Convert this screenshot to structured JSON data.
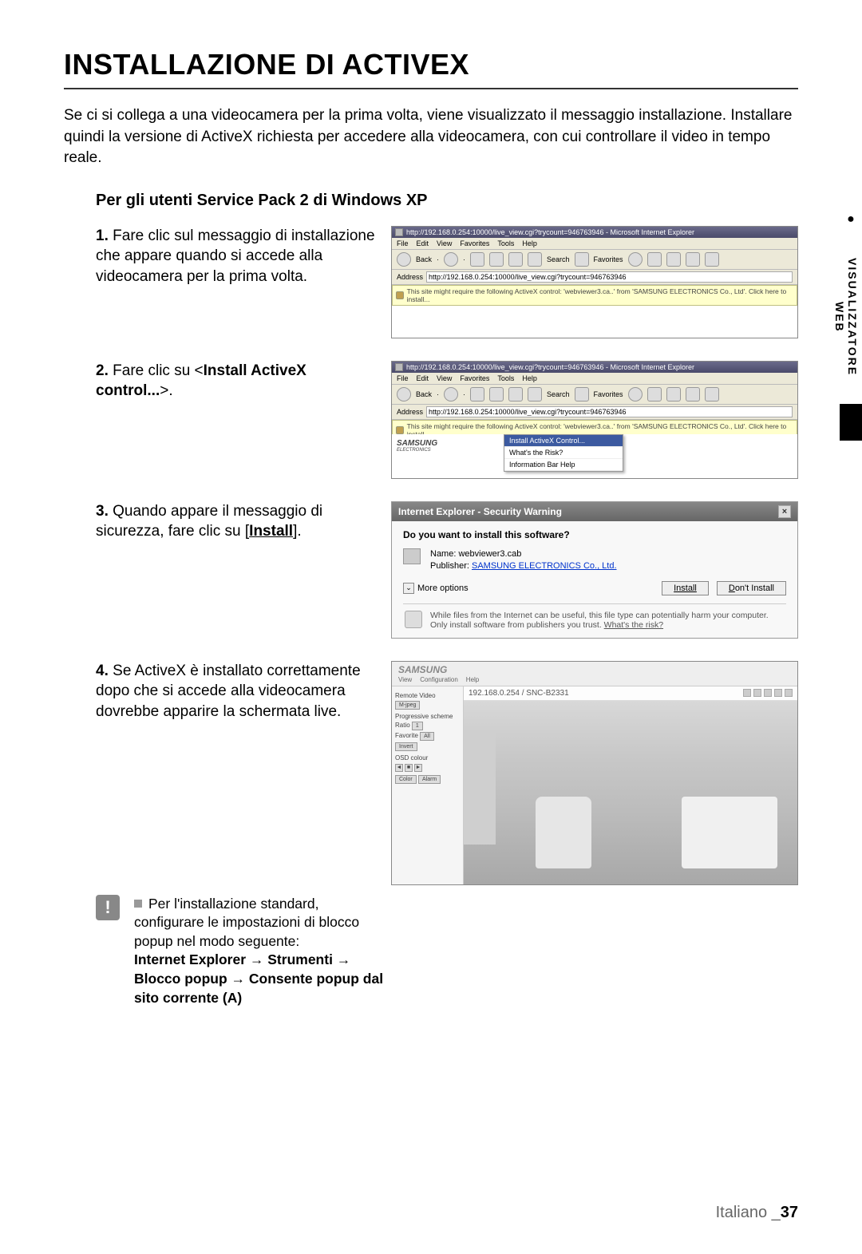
{
  "title": "INSTALLAZIONE DI ACTIVEX",
  "intro": "Se ci si collega a una videocamera per la prima volta, viene visualizzato il messaggio installazione. Installare quindi la versione di ActiveX richiesta per accedere alla videocamera, con cui controllare il video in tempo reale.",
  "subheading": "Per gli utenti Service Pack 2 di Windows XP",
  "steps": [
    {
      "num": "1.",
      "text": "Fare clic sul messaggio di installazione che appare quando si accede alla videocamera per la prima volta."
    },
    {
      "num": "2.",
      "pre": "Fare clic su <",
      "bold": "Install ActiveX control...",
      "post": ">."
    },
    {
      "num": "3.",
      "pre": "Quando appare il messaggio di sicurezza, fare clic su [",
      "boldunder": "Install",
      "post": "]."
    },
    {
      "num": "4.",
      "text": "Se ActiveX è installato correttamente dopo che si accede alla videocamera dovrebbe apparire la schermata live."
    }
  ],
  "note": {
    "line1": "Per l'installazione standard, configurare le impostazioni di blocco popup nel modo seguente:",
    "path": "Internet Explorer → Strumenti → Blocco popup → Consente popup dal sito corrente (A)"
  },
  "ie": {
    "title_url": "http://192.168.0.254:10000/live_view.cgi?trycount=946763946 - Microsoft Internet Explorer",
    "menus": [
      "File",
      "Edit",
      "View",
      "Favorites",
      "Tools",
      "Help"
    ],
    "tb_back": "Back",
    "tb_search": "Search",
    "tb_fav": "Favorites",
    "addr_label": "Address",
    "addr_url": "http://192.168.0.254:10000/live_view.cgi?trycount=946763946",
    "info_bar": "This site might require the following ActiveX control: 'webviewer3.ca..' from 'SAMSUNG ELECTRONICS Co., Ltd'. Click here to install...",
    "context": {
      "install": "Install ActiveX Control...",
      "risk": "What's the Risk?",
      "help": "Information Bar Help"
    },
    "samsung": "SAMSUNG",
    "samsung_sub": "ELECTRONICS"
  },
  "sec": {
    "title": "Internet Explorer - Security Warning",
    "q": "Do you want to install this software?",
    "name_label": "Name:",
    "name": "webviewer3.cab",
    "pub_label": "Publisher:",
    "pub": "SAMSUNG ELECTRONICS Co., Ltd.",
    "more": "More options",
    "install": "Install",
    "dont": "Don't Install",
    "foot_a": "While files from the Internet can be useful, this file type can potentially harm your computer. Only install software from publishers you trust. ",
    "foot_link": "What's the risk?"
  },
  "live": {
    "brand": "SAMSUNG",
    "menus": [
      "View",
      "Configuration",
      "Help"
    ],
    "url": "192.168.0.254 / SNC-B2331",
    "side": {
      "rv": "Remote Video",
      "rv_sel": "M-jpeg",
      "ps": "Progressive scheme",
      "ratio": "Ratio",
      "ratio_v": "1",
      "fav": "Favorite",
      "fav_v": "All",
      "invert": "Invert",
      "osd": "OSD colour"
    }
  },
  "side_tab": "VISUALIZZATORE WEB",
  "footer_lang": "Italiano _",
  "footer_page": "37"
}
